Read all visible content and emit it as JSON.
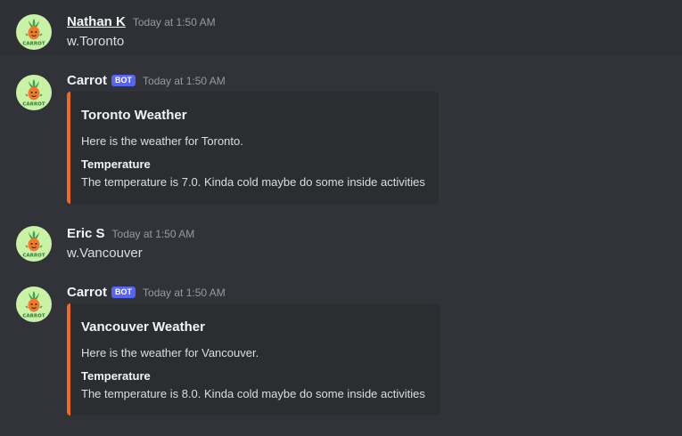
{
  "colors": {
    "background": "#313338",
    "hover_background": "#2e3035",
    "embed_background": "#2b2d31",
    "embed_accent": "#f26b1d",
    "bot_tag": "#5865f2",
    "avatar_background": "#c9f2a6"
  },
  "messages": [
    {
      "author": "Nathan K",
      "timestamp": "Today at 1:50 AM",
      "text": "w.Toronto",
      "avatar_icon": "carrot-avatar-icon",
      "avatar_text": "CARROT"
    },
    {
      "author": "Carrot",
      "bot_tag": "BOT",
      "timestamp": "Today at 1:50 AM",
      "avatar_icon": "carrot-avatar-icon",
      "avatar_text": "CARROT",
      "embed": {
        "title": "Toronto Weather",
        "description": "Here is the weather for Toronto.",
        "field_name": "Temperature",
        "field_value": "The temperature is 7.0. Kinda cold maybe do some inside activities"
      }
    },
    {
      "author": "Eric S",
      "timestamp": "Today at 1:50 AM",
      "text": "w.Vancouver",
      "avatar_icon": "carrot-avatar-icon",
      "avatar_text": "CARROT"
    },
    {
      "author": "Carrot",
      "bot_tag": "BOT",
      "timestamp": "Today at 1:50 AM",
      "avatar_icon": "carrot-avatar-icon",
      "avatar_text": "CARROT",
      "embed": {
        "title": "Vancouver Weather",
        "description": "Here is the weather for Vancouver.",
        "field_name": "Temperature",
        "field_value": "The temperature is 8.0. Kinda cold maybe do some inside activities"
      }
    }
  ]
}
